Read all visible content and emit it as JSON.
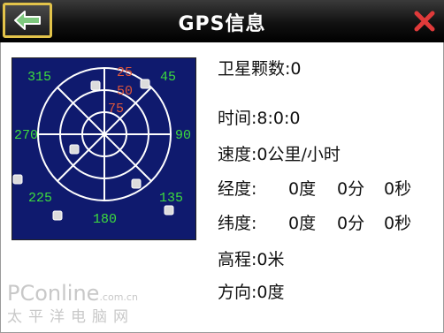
{
  "header": {
    "title": "GPS信息",
    "back_icon": "arrow-left-icon",
    "close_icon": "close-x-icon",
    "accent_color": "#e2c34a",
    "close_color": "#e03a3a"
  },
  "compass": {
    "bearings": [
      "315",
      "45",
      "270",
      "90",
      "225",
      "135",
      "180"
    ],
    "elevations": [
      "25",
      "50",
      "75"
    ],
    "background_color": "#0f1a6e",
    "bearing_color": "#3ddc3d",
    "elevation_color": "#e0563a"
  },
  "info": {
    "satellites": {
      "label": "卫星颗数:",
      "value": "0"
    },
    "time": {
      "label": "时间:",
      "value": "8:0:0"
    },
    "speed": {
      "label": "速度:",
      "value": "0公里/小时"
    },
    "longitude": {
      "label": "经度:",
      "deg": "0度",
      "min": "0分",
      "sec": "0秒"
    },
    "latitude": {
      "label": "纬度:",
      "deg": "0度",
      "min": "0分",
      "sec": "0秒"
    },
    "altitude": {
      "label": "高程:",
      "value": "0米"
    },
    "heading": {
      "label": "方向:",
      "value": "0度"
    }
  },
  "watermark": {
    "main": "PConline",
    "sub": ".com.cn",
    "cn": "太平洋电脑网"
  }
}
